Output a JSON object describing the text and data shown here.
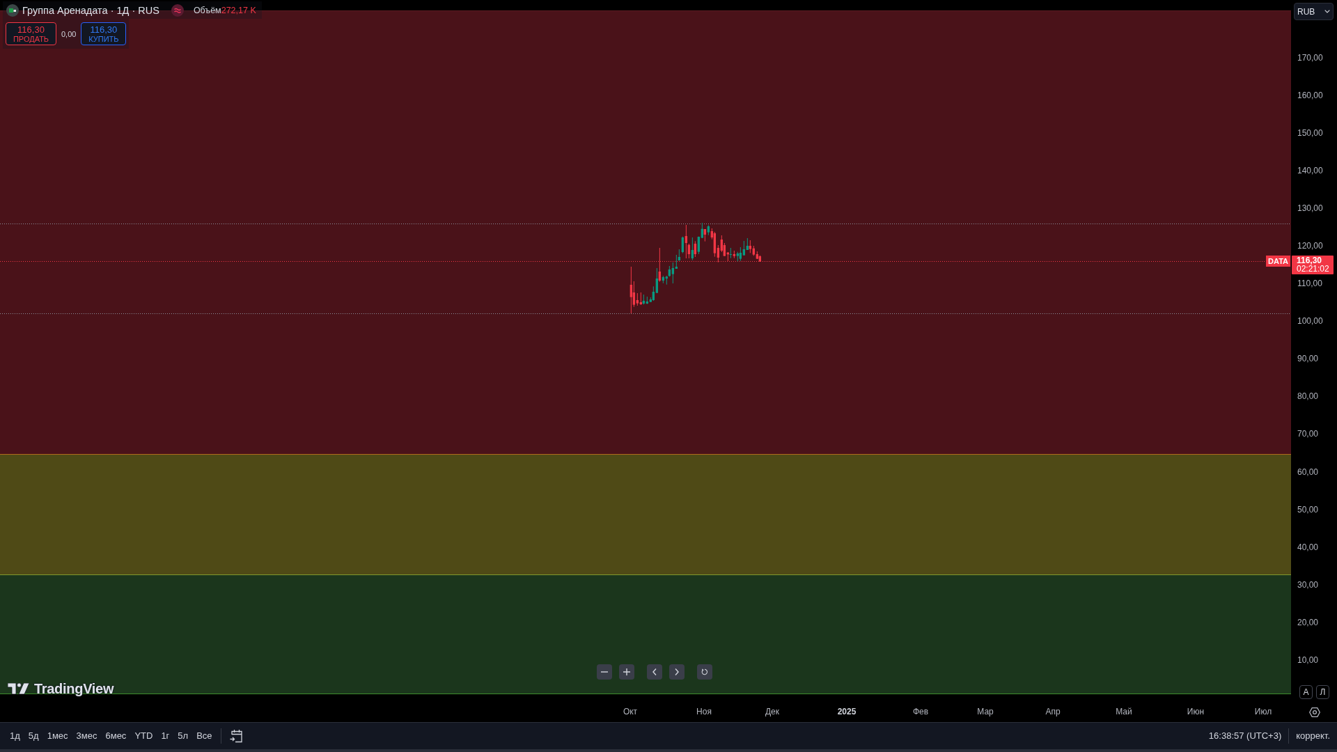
{
  "legend": {
    "symbol": "Группа Аренадата · 1Д · RUS",
    "volume_label": "Объём",
    "volume_value": "272,17 K"
  },
  "trade_panel": {
    "sell": {
      "price": "116,30",
      "label": "ПРОДАТЬ"
    },
    "spread": "0,00",
    "buy": {
      "price": "116,30",
      "label": "КУПИТЬ"
    }
  },
  "currency_menu": {
    "value": "RUB"
  },
  "price_scale": {
    "labels": [
      "170,00",
      "160,00",
      "150,00",
      "140,00",
      "130,00",
      "120,00",
      "110,00",
      "100,00",
      "90,00",
      "80,00",
      "70,00",
      "60,00",
      "50,00",
      "40,00",
      "30,00",
      "20,00",
      "10,00"
    ]
  },
  "last_price": {
    "symbol": "DATA",
    "price": "116,30",
    "countdown": "02:21:02"
  },
  "scale_buttons": [
    "A",
    "Л"
  ],
  "branding": {
    "text": "TradingView"
  },
  "time_scale": {
    "labels": [
      {
        "text": "Окт",
        "kind": "month"
      },
      {
        "text": "Ноя",
        "kind": "month"
      },
      {
        "text": "Дек",
        "kind": "month"
      },
      {
        "text": "2025",
        "kind": "year"
      },
      {
        "text": "Фев",
        "kind": "month"
      },
      {
        "text": "Мар",
        "kind": "month"
      },
      {
        "text": "Апр",
        "kind": "month"
      },
      {
        "text": "Май",
        "kind": "month"
      },
      {
        "text": "Июн",
        "kind": "month"
      },
      {
        "text": "Июл",
        "kind": "month"
      }
    ]
  },
  "bottom_toolbar": {
    "ranges": [
      "1д",
      "5д",
      "1мес",
      "3мес",
      "6мес",
      "YTD",
      "1г",
      "5л",
      "Все"
    ],
    "time": "16:38:57 (UTC+3)",
    "adjustment": "коррект."
  }
}
